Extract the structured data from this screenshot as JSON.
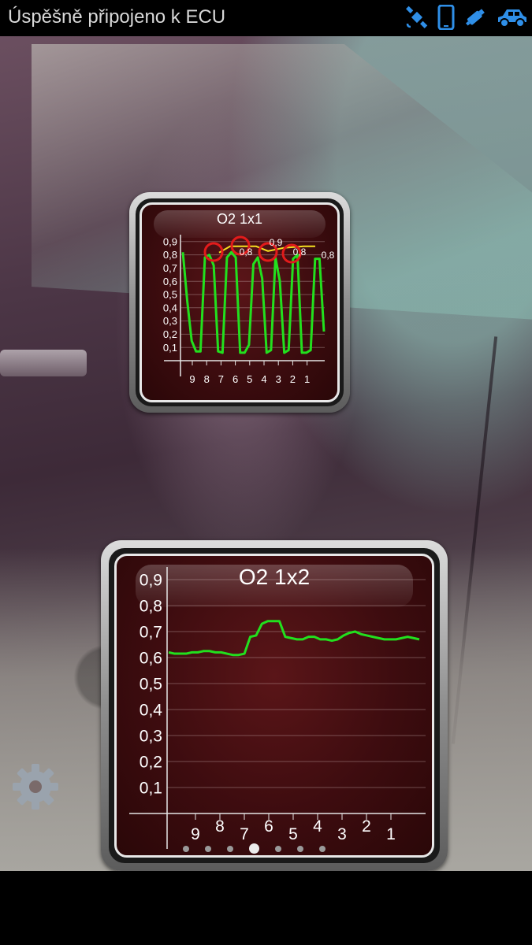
{
  "status_bar": {
    "text": "Úspěšně připojeno k ECU",
    "icons": [
      "gps-icon",
      "phone-icon",
      "obd-adapter-icon",
      "car-icon"
    ],
    "icon_color": "#2f8fe8"
  },
  "gauges": [
    {
      "title": "O2 1x1",
      "y_labels": [
        "0,9",
        "0,8",
        "0,7",
        "0,6",
        "0,5",
        "0,4",
        "0,3",
        "0,2",
        "0,1"
      ],
      "x_labels": [
        "9",
        "8",
        "7",
        "6",
        "5",
        "4",
        "3",
        "2",
        "1"
      ],
      "peak_labels": [
        "0,8",
        "0,9",
        "0,8",
        "0,8"
      ],
      "line_color": "#22e01e",
      "peak_line_color": "#f5e020",
      "marker_color": "#e21b1b"
    },
    {
      "title": "O2 1x2",
      "y_labels": [
        "0,9",
        "0,8",
        "0,7",
        "0,6",
        "0,5",
        "0,4",
        "0,3",
        "0,2",
        "0,1"
      ],
      "x_labels": [
        "9",
        "8",
        "7",
        "6",
        "5",
        "4",
        "3",
        "2",
        "1"
      ],
      "line_color": "#22e01e"
    }
  ],
  "chart_data": [
    {
      "type": "line",
      "title": "O2 1x1",
      "ylim": [
        0,
        0.95
      ],
      "x": [
        9,
        8,
        7,
        6,
        5,
        4,
        3,
        2,
        1
      ],
      "series": [
        {
          "values": [
            0.82,
            0.45,
            0.15,
            0.07,
            0.07,
            0.78,
            0.8,
            0.72,
            0.07,
            0.06,
            0.78,
            0.82,
            0.78,
            0.06,
            0.06,
            0.12,
            0.73,
            0.78,
            0.62,
            0.06,
            0.08,
            0.78,
            0.6,
            0.06,
            0.08,
            0.77,
            0.8,
            0.06,
            0.06,
            0.08,
            0.77,
            0.77,
            0.22
          ]
        }
      ]
    },
    {
      "type": "line",
      "title": "O2 1x2",
      "ylim": [
        0,
        0.95
      ],
      "x": [
        9,
        8,
        7,
        6,
        5,
        4,
        3,
        2,
        1
      ],
      "series": [
        {
          "values": [
            0.62,
            0.615,
            0.615,
            0.615,
            0.62,
            0.62,
            0.625,
            0.625,
            0.62,
            0.62,
            0.615,
            0.61,
            0.61,
            0.615,
            0.68,
            0.685,
            0.73,
            0.74,
            0.74,
            0.74,
            0.68,
            0.675,
            0.67,
            0.67,
            0.68,
            0.68,
            0.67,
            0.67,
            0.665,
            0.67,
            0.685,
            0.695,
            0.7,
            0.69,
            0.685,
            0.68,
            0.675,
            0.67,
            0.67,
            0.67,
            0.675,
            0.68,
            0.675,
            0.67
          ]
        }
      ]
    }
  ],
  "pager": {
    "count": 7,
    "active": 3
  },
  "settings_icon": "gear-icon"
}
